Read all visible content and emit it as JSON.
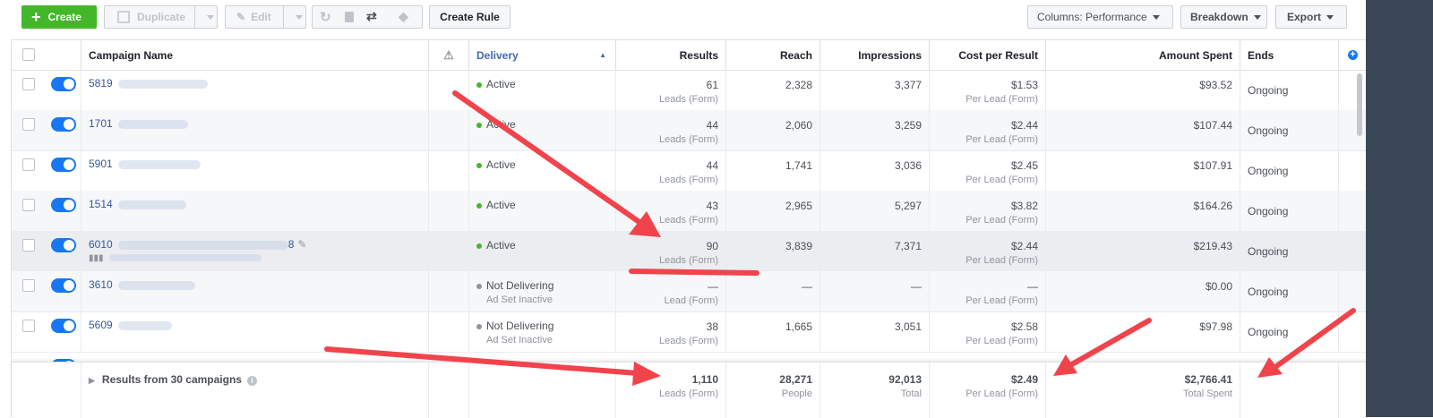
{
  "toolbar": {
    "create": "Create",
    "duplicate": "Duplicate",
    "edit": "Edit",
    "create_rule": "Create Rule",
    "columns": "Columns: Performance",
    "breakdown": "Breakdown",
    "export": "Export"
  },
  "headers": {
    "campaign_name": "Campaign Name",
    "delivery": "Delivery",
    "results": "Results",
    "reach": "Reach",
    "impressions": "Impressions",
    "cost_per_result": "Cost per Result",
    "amount_spent": "Amount Spent",
    "ends": "Ends"
  },
  "rows": [
    {
      "name": "5819",
      "delivery": "Active",
      "delivery_sub": "",
      "results": "61",
      "results_sub": "Leads (Form)",
      "reach": "2,328",
      "impressions": "3,377",
      "cpr": "$1.53",
      "cpr_sub": "Per Lead (Form)",
      "spent": "$93.52",
      "ends": "Ongoing"
    },
    {
      "name": "1701",
      "delivery": "Active",
      "delivery_sub": "",
      "results": "44",
      "results_sub": "Leads (Form)",
      "reach": "2,060",
      "impressions": "3,259",
      "cpr": "$2.44",
      "cpr_sub": "Per Lead (Form)",
      "spent": "$107.44",
      "ends": "Ongoing"
    },
    {
      "name": "5901",
      "delivery": "Active",
      "delivery_sub": "",
      "results": "44",
      "results_sub": "Leads (Form)",
      "reach": "1,741",
      "impressions": "3,036",
      "cpr": "$2.45",
      "cpr_sub": "Per Lead (Form)",
      "spent": "$107.91",
      "ends": "Ongoing"
    },
    {
      "name": "1514",
      "delivery": "Active",
      "delivery_sub": "",
      "results": "43",
      "results_sub": "Leads (Form)",
      "reach": "2,965",
      "impressions": "5,297",
      "cpr": "$3.82",
      "cpr_sub": "Per Lead (Form)",
      "spent": "$164.26",
      "ends": "Ongoing"
    },
    {
      "name": "6010",
      "name_suffix": "8",
      "delivery": "Active",
      "delivery_sub": "",
      "results": "90",
      "results_sub": "Leads (Form)",
      "reach": "3,839",
      "impressions": "7,371",
      "cpr": "$2.44",
      "cpr_sub": "Per Lead (Form)",
      "spent": "$219.43",
      "ends": "Ongoing"
    },
    {
      "name": "3610",
      "delivery": "Not Delivering",
      "delivery_sub": "Ad Set Inactive",
      "results": "—",
      "results_sub": "Lead (Form)",
      "reach": "—",
      "impressions": "—",
      "cpr": "—",
      "cpr_sub": "Per Lead (Form)",
      "spent": "$0.00",
      "ends": "Ongoing"
    },
    {
      "name": "5609",
      "delivery": "Not Delivering",
      "delivery_sub": "Ad Set Inactive",
      "results": "38",
      "results_sub": "Leads (Form)",
      "reach": "1,665",
      "impressions": "3,051",
      "cpr": "$2.58",
      "cpr_sub": "Per Lead (Form)",
      "spent": "$97.98",
      "ends": "Ongoing"
    }
  ],
  "footer": {
    "label": "Results from 30 campaigns",
    "results": "1,110",
    "results_sub": "Leads (Form)",
    "reach": "28,271",
    "reach_sub": "People",
    "impressions": "92,013",
    "impressions_sub": "Total",
    "cpr": "$2.49",
    "cpr_sub": "Per Lead (Form)",
    "spent": "$2,766.41",
    "spent_sub": "Total Spent"
  },
  "colors": {
    "arrow": "#f0434b",
    "create_green": "#42b72a",
    "toggle_blue": "#1877f2",
    "sidebar": "#3a4756"
  }
}
